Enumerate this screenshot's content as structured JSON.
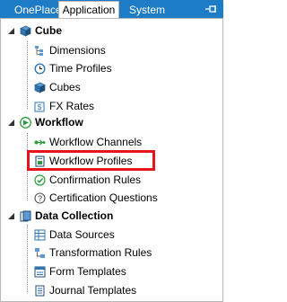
{
  "tabs": [
    {
      "label": "OnePlace",
      "active": false
    },
    {
      "label": "Application",
      "active": true
    },
    {
      "label": "System",
      "active": false
    }
  ],
  "tree": {
    "cube": {
      "label": "Cube",
      "items": [
        {
          "label": "Dimensions",
          "icon": "dimensions-icon"
        },
        {
          "label": "Time Profiles",
          "icon": "clock-icon"
        },
        {
          "label": "Cubes",
          "icon": "cube-icon"
        },
        {
          "label": "FX Rates",
          "icon": "fx-rates-icon"
        }
      ]
    },
    "workflow": {
      "label": "Workflow",
      "items": [
        {
          "label": "Workflow Channels",
          "icon": "channels-icon"
        },
        {
          "label": "Workflow Profiles",
          "icon": "workflow-profile-icon",
          "highlighted": true
        },
        {
          "label": "Confirmation Rules",
          "icon": "confirmation-icon"
        },
        {
          "label": "Certification Questions",
          "icon": "certification-icon"
        }
      ]
    },
    "data_collection": {
      "label": "Data Collection",
      "items": [
        {
          "label": "Data Sources",
          "icon": "data-sources-icon"
        },
        {
          "label": "Transformation Rules",
          "icon": "transformation-icon"
        },
        {
          "label": "Form Templates",
          "icon": "form-templates-icon"
        },
        {
          "label": "Journal Templates",
          "icon": "journal-templates-icon"
        }
      ]
    }
  },
  "colors": {
    "tabbar": "#1e7bc6",
    "highlight": "#e8141b",
    "workflow_green": "#2a9d3a"
  }
}
